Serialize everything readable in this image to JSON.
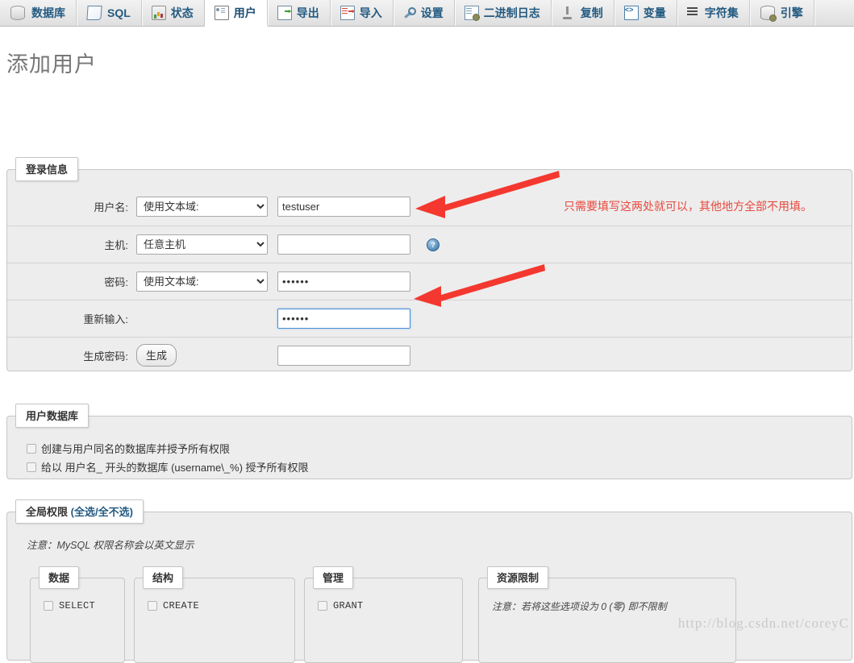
{
  "nav": {
    "tabs": [
      {
        "label": "数据库",
        "icon": "database-icon",
        "icon_class": "ic-db",
        "active": false
      },
      {
        "label": "SQL",
        "icon": "sql-icon",
        "icon_class": "ic-sql",
        "active": false
      },
      {
        "label": "状态",
        "icon": "status-icon",
        "icon_class": "ic-status",
        "active": false
      },
      {
        "label": "用户",
        "icon": "users-icon",
        "icon_class": "ic-users",
        "active": true
      },
      {
        "label": "导出",
        "icon": "export-icon",
        "icon_class": "ic-export",
        "active": false
      },
      {
        "label": "导入",
        "icon": "import-icon",
        "icon_class": "ic-import",
        "active": false
      },
      {
        "label": "设置",
        "icon": "settings-icon",
        "icon_class": "ic-settings",
        "active": false
      },
      {
        "label": "二进制日志",
        "icon": "binlog-icon",
        "icon_class": "ic-binlog",
        "active": false
      },
      {
        "label": "复制",
        "icon": "replication-icon",
        "icon_class": "ic-replication",
        "active": false
      },
      {
        "label": "变量",
        "icon": "variables-icon",
        "icon_class": "ic-variables",
        "active": false
      },
      {
        "label": "字符集",
        "icon": "charset-icon",
        "icon_class": "ic-charset",
        "active": false
      },
      {
        "label": "引擎",
        "icon": "engines-icon",
        "icon_class": "ic-engines",
        "active": false
      }
    ]
  },
  "page": {
    "title": "添加用户"
  },
  "login": {
    "legend": "登录信息",
    "rows": {
      "username": {
        "label": "用户名:",
        "select_value": "使用文本域:",
        "input_value": "testuser",
        "input_placeholder": ""
      },
      "host": {
        "label": "主机:",
        "select_value": "任意主机",
        "input_value": "",
        "input_placeholder": "",
        "help_icon_text": "?"
      },
      "password": {
        "label": "密码:",
        "select_value": "使用文本域:",
        "input_value": "••••••"
      },
      "retype": {
        "label": "重新输入:",
        "input_value": "••••••"
      },
      "generate": {
        "label": "生成密码:",
        "button_label": "生成",
        "input_value": ""
      }
    }
  },
  "userdb": {
    "legend": "用户数据库",
    "options": [
      "创建与用户同名的数据库并授予所有权限",
      "给以 用户名_ 开头的数据库 (username\\_%) 授予所有权限"
    ]
  },
  "privileges": {
    "legend_main": "全局权限",
    "legend_select_all": "全选",
    "legend_sep": "/",
    "legend_unselect_all": "全不选",
    "note": "注意：MySQL 权限名称会以英文显示",
    "boxes": [
      {
        "legend": "数据",
        "items": [
          "SELECT"
        ]
      },
      {
        "legend": "结构",
        "items": [
          "CREATE"
        ]
      },
      {
        "legend": "管理",
        "items": [
          "GRANT"
        ]
      }
    ],
    "resource_box": {
      "legend": "资源限制",
      "note": "注意：若将这些选项设为 0 (零) 即不限制"
    }
  },
  "annotations": {
    "note_text": "只需要填写这两处就可以，其他地方全部不用填。",
    "arrow_color": "#f4382f"
  },
  "watermark": {
    "text": "http://blog.csdn.net/coreyC"
  }
}
